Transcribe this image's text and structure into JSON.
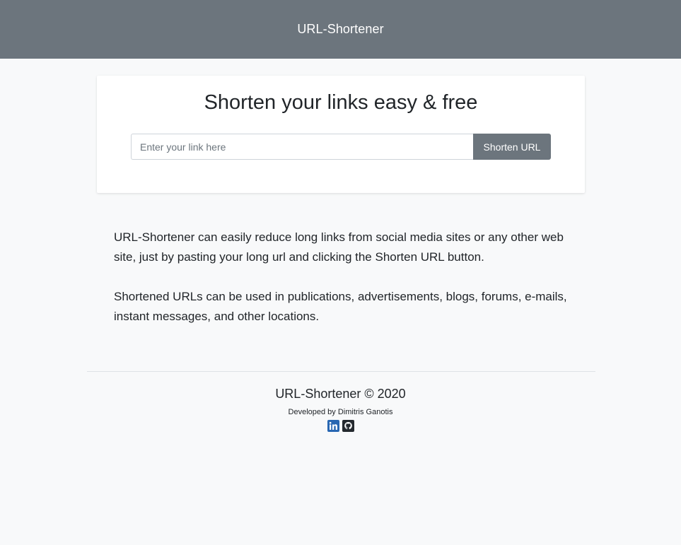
{
  "navbar": {
    "brand": "URL-Shortener"
  },
  "card": {
    "headline": "Shorten your links easy & free",
    "input_placeholder": "Enter your link here",
    "input_value": "",
    "button_label": "Shorten URL"
  },
  "description": {
    "paragraphs": [
      "URL-Shortener can easily reduce long links from social media sites or any other web site, just by pasting your long url and clicking the Shorten URL button.",
      "Shortened URLs can be used in publications, advertisements, blogs, forums, e-mails, instant messages, and other locations."
    ]
  },
  "footer": {
    "copyright": "URL-Shortener © 2020",
    "developer": "Developed by Dimitris Ganotis",
    "socials": [
      {
        "icon": "linkedin-icon",
        "color": "#2867b2"
      },
      {
        "icon": "github-icon",
        "color": "#24292e"
      }
    ]
  },
  "colors": {
    "navbar_bg": "#6c757d",
    "page_bg": "#f8f9fa",
    "button_bg": "#6c757d"
  }
}
